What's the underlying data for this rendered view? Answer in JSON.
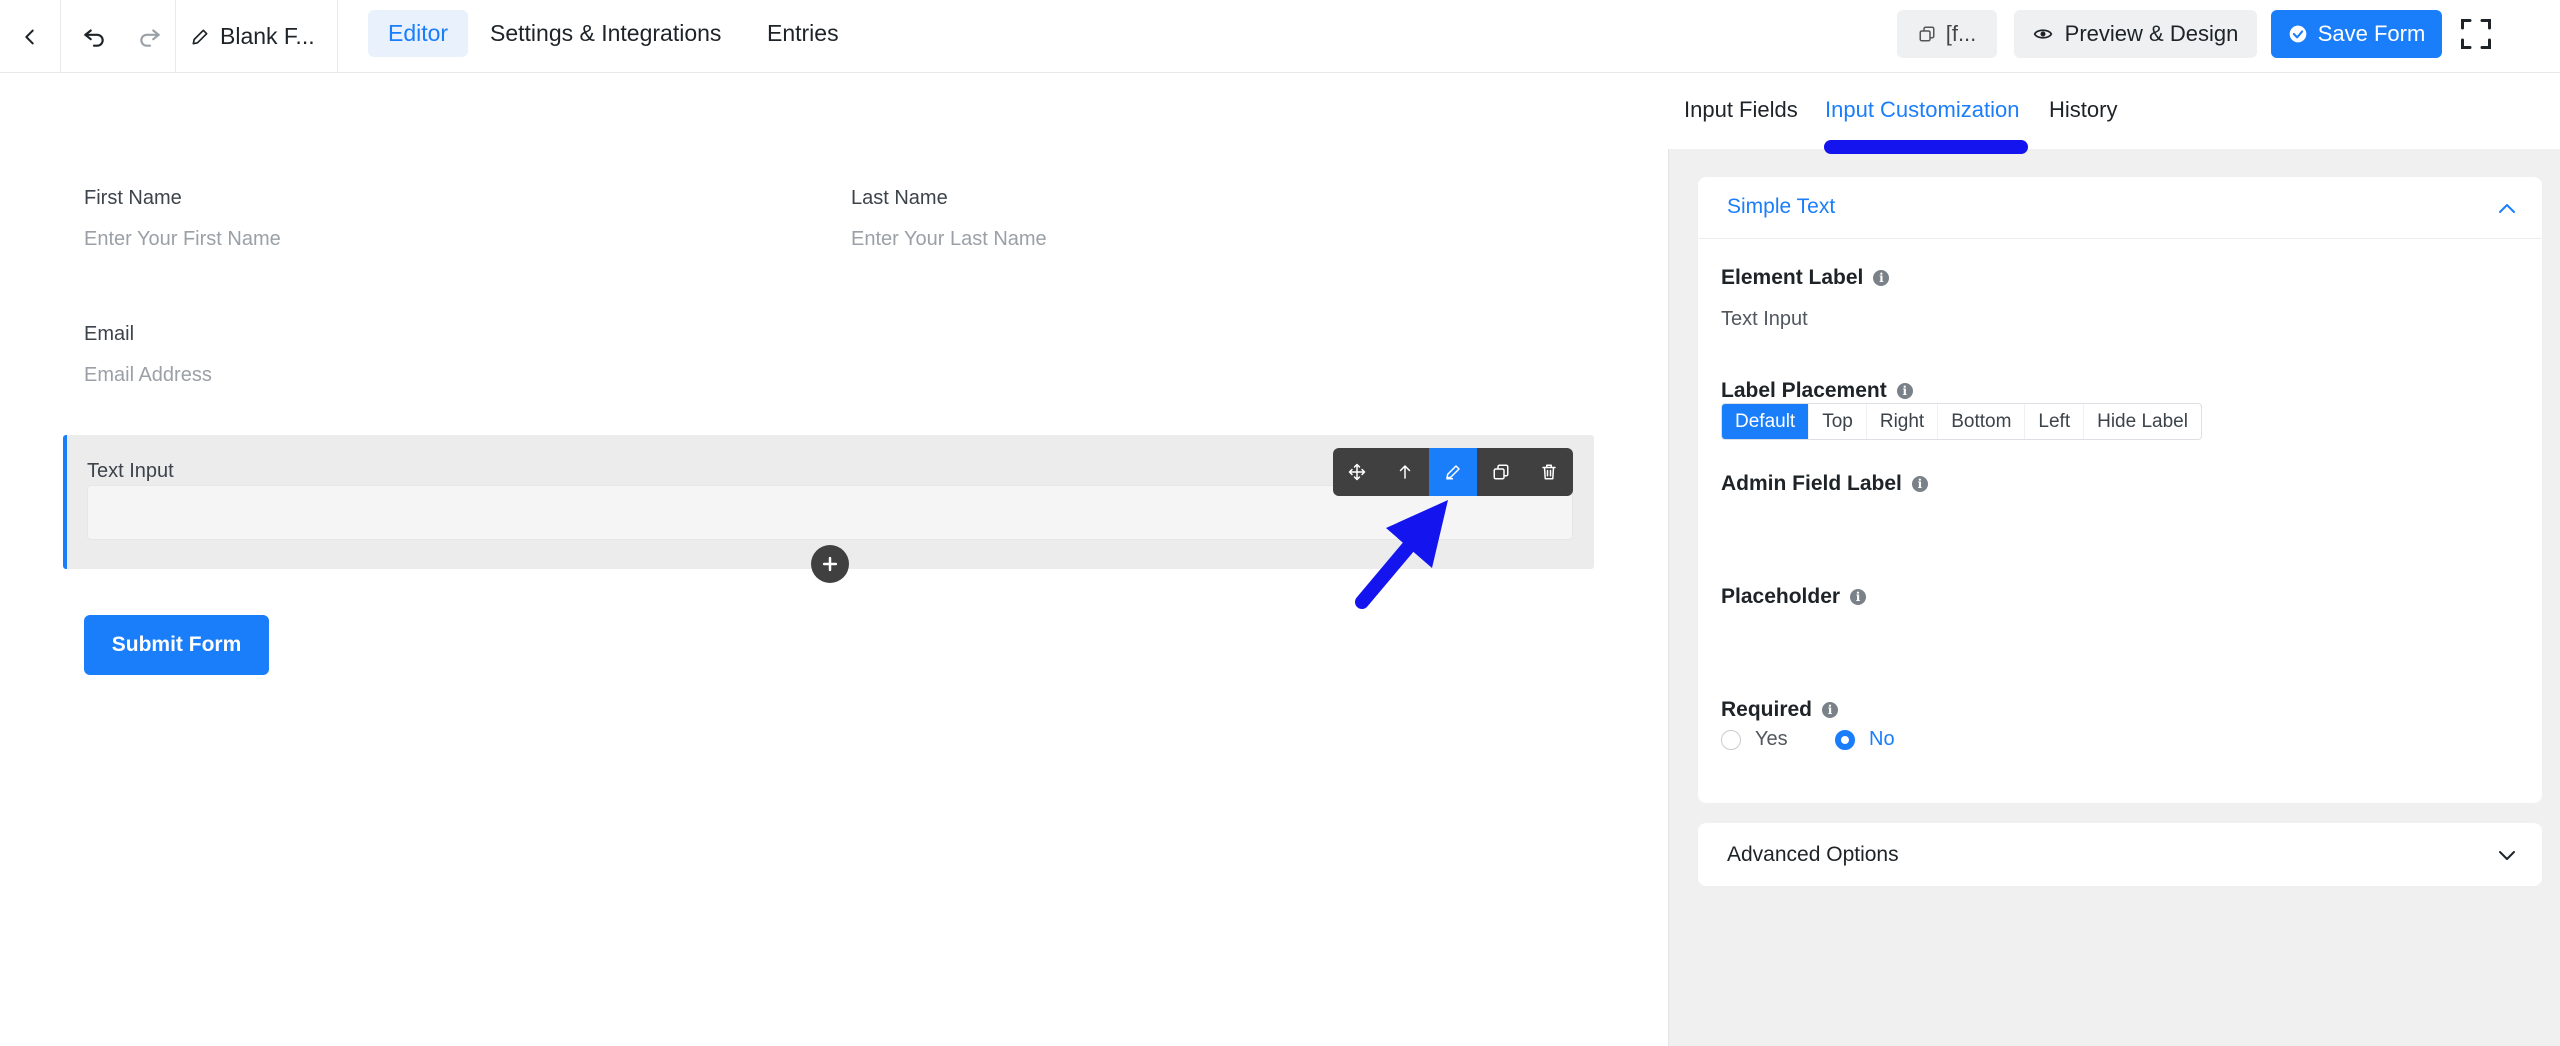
{
  "header": {
    "form_title": "Blank F...",
    "tabs": [
      {
        "label": "Editor",
        "active": true
      },
      {
        "label": "Settings & Integrations",
        "active": false
      },
      {
        "label": "Entries",
        "active": false
      }
    ],
    "shortcode_label": "[f...",
    "preview_label": "Preview & Design",
    "save_label": "Save Form"
  },
  "form": {
    "first_name": {
      "label": "First Name",
      "placeholder": "Enter Your First Name"
    },
    "last_name": {
      "label": "Last Name",
      "placeholder": "Enter Your Last Name"
    },
    "email": {
      "label": "Email",
      "placeholder": "Email Address"
    },
    "text_input": {
      "label": "Text Input"
    },
    "submit_label": "Submit Form"
  },
  "panel": {
    "tabs": [
      {
        "label": "Input Fields",
        "active": false
      },
      {
        "label": "Input Customization",
        "active": true
      },
      {
        "label": "History",
        "active": false
      }
    ],
    "section_title": "Simple Text",
    "element_label": {
      "label": "Element Label",
      "value": "Text Input"
    },
    "label_placement": {
      "label": "Label Placement",
      "options": [
        "Default",
        "Top",
        "Right",
        "Bottom",
        "Left",
        "Hide Label"
      ],
      "selected": "Default"
    },
    "admin_field_label": {
      "label": "Admin Field Label"
    },
    "placeholder": {
      "label": "Placeholder"
    },
    "required": {
      "label": "Required",
      "yes": "Yes",
      "no": "No",
      "selected": "No"
    },
    "advanced_title": "Advanced Options"
  },
  "colors": {
    "accent": "#1a7efb",
    "annotation_arrow": "#1414ef",
    "toolbar_bg": "#404040"
  }
}
